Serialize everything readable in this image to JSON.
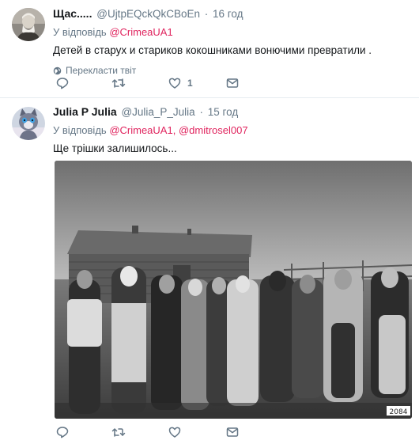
{
  "tweets": [
    {
      "fullname": "Щас.....",
      "username": "@UjtpEQckQkCBoEn",
      "separator": "·",
      "time": "16 год",
      "reply_prefix": "У відповідь",
      "mentions": [
        "@CrimeaUA1"
      ],
      "text": "Детей в старух и стариков кокошниками вонючими превратили .",
      "translate_label": "Перекласти твіт",
      "actions": {
        "reply_count": "",
        "retweet_count": "",
        "like_count": "1"
      }
    },
    {
      "fullname": "Julia P Julia",
      "username": "@Julia_P_Julia",
      "separator": "·",
      "time": "15 год",
      "reply_prefix": "У відповідь",
      "mentions": [
        "@CrimeaUA1",
        "@dmitrosel007"
      ],
      "mention_separator": ",",
      "text": "Ще трішки залишилось...",
      "media": {
        "photo_number": "2084"
      },
      "actions": {
        "reply_count": "",
        "retweet_count": "",
        "like_count": ""
      }
    }
  ],
  "colors": {
    "mention": "#e0245e",
    "secondary": "#657786",
    "text": "#14171a",
    "divider": "#e6ecf0"
  },
  "icons": [
    "reply-icon",
    "retweet-icon",
    "like-icon",
    "message-icon",
    "globe-icon"
  ]
}
